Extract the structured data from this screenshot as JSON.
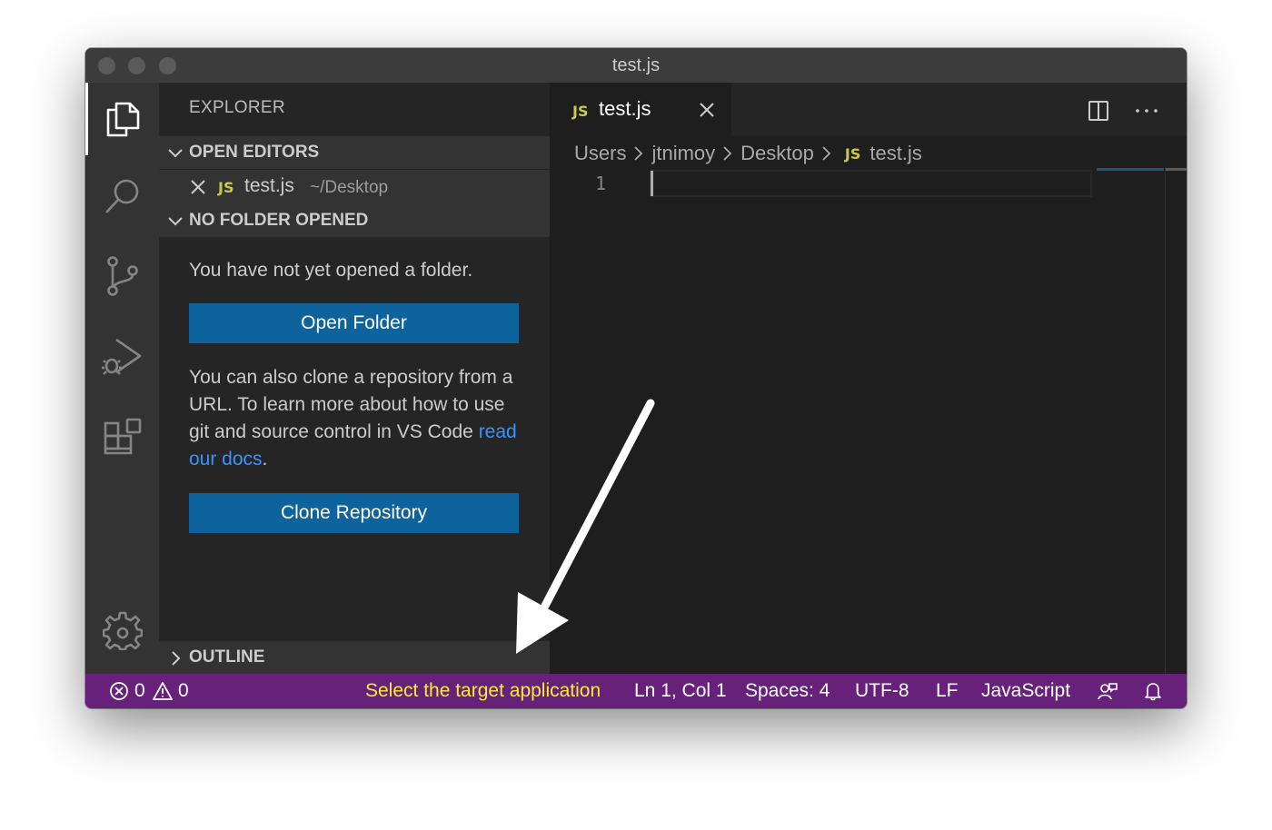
{
  "window": {
    "title": "test.js"
  },
  "sidebar": {
    "title": "EXPLORER",
    "open_editors": {
      "header": "OPEN EDITORS",
      "file": {
        "badge": "JS",
        "name": "test.js",
        "path": "~/Desktop"
      }
    },
    "no_folder": {
      "header": "NO FOLDER OPENED",
      "message": "You have not yet opened a folder.",
      "open_folder_button": "Open Folder",
      "clone_text_before": "You can also clone a repository from a URL. To learn more about how to use git and source control in VS Code ",
      "clone_link": "read our docs",
      "clone_text_after": ".",
      "clone_button": "Clone Repository"
    },
    "outline": {
      "header": "OUTLINE"
    }
  },
  "editor": {
    "tab": {
      "badge": "JS",
      "name": "test.js"
    },
    "breadcrumbs": [
      "Users",
      "jtnimoy",
      "Desktop"
    ],
    "breadcrumb_file": {
      "badge": "JS",
      "name": "test.js"
    },
    "line_number": "1"
  },
  "statusbar": {
    "errors": "0",
    "warnings": "0",
    "message": "Select the target application",
    "position": "Ln 1, Col 1",
    "spaces": "Spaces: 4",
    "encoding": "UTF-8",
    "eol": "LF",
    "language": "JavaScript"
  },
  "icons": {
    "explorer": "files-icon",
    "search": "search-icon",
    "scm": "source-control-icon",
    "debug": "run-debug-icon",
    "extensions": "extensions-icon",
    "settings": "gear-icon"
  },
  "colors": {
    "statusbar": "#68217a",
    "button": "#0e639c",
    "js_badge": "#cbcb41",
    "link": "#3794ff",
    "status_message": "#ffeb3b"
  }
}
